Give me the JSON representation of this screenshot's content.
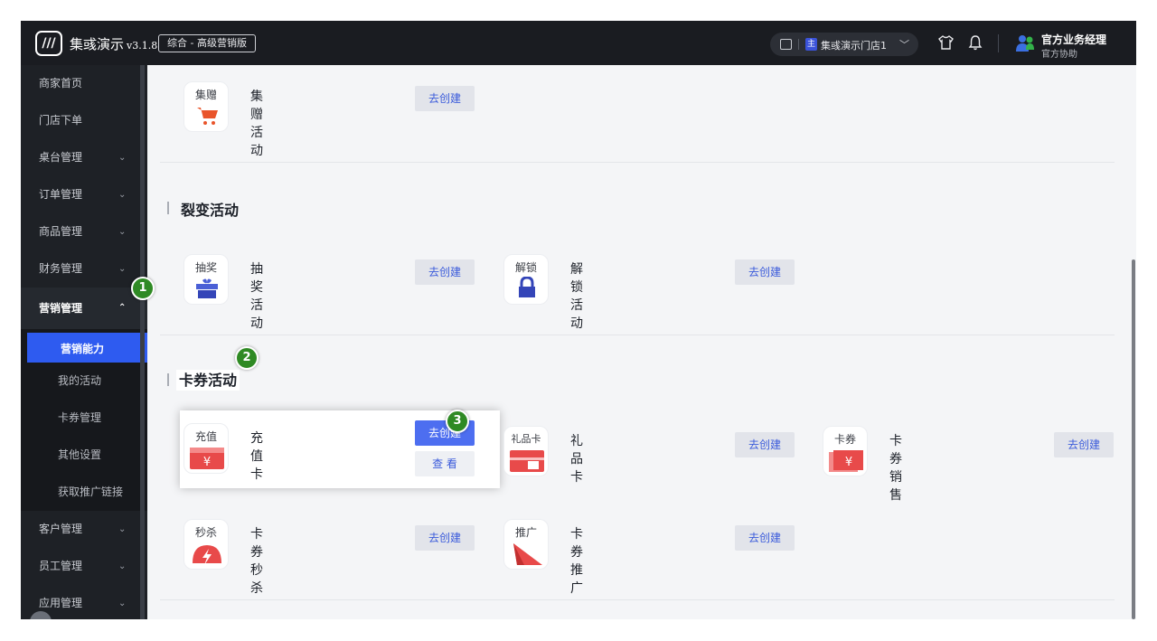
{
  "topbar": {
    "logo_glyph": "///",
    "brand": "集彧演示",
    "version": "v3.1.8",
    "plan": "综合 - 高级营销版",
    "store_tag": "主",
    "store_name": "集彧演示门店1",
    "user_name": "官方业务经理",
    "user_role": "官方协助"
  },
  "sidebar": {
    "items": [
      {
        "label": "商家首页"
      },
      {
        "label": "门店下单"
      },
      {
        "label": "桌台管理"
      },
      {
        "label": "订单管理"
      },
      {
        "label": "商品管理"
      },
      {
        "label": "财务管理"
      },
      {
        "label": "营销管理"
      },
      {
        "label": "客户管理"
      },
      {
        "label": "员工管理"
      },
      {
        "label": "应用管理"
      }
    ],
    "sub_items": [
      {
        "label": "营销能力"
      },
      {
        "label": "我的活动"
      },
      {
        "label": "卡券管理"
      },
      {
        "label": "其他设置"
      },
      {
        "label": "获取推广链接"
      }
    ]
  },
  "sections": {
    "gift": {
      "card": {
        "icon_label": "集赠",
        "name": "集赠活动",
        "button": "去创建"
      }
    },
    "fission": {
      "title": "裂变活动",
      "cards": [
        {
          "icon_label": "抽奖",
          "name": "抽奖活动",
          "button": "去创建"
        },
        {
          "icon_label": "解锁",
          "name": "解锁活动",
          "button": "去创建"
        }
      ]
    },
    "coupon": {
      "title": "卡券活动",
      "cards": [
        {
          "icon_label": "充值",
          "name": "充值卡",
          "button": "去创建",
          "view": "查 看"
        },
        {
          "icon_label": "礼品卡",
          "name": "礼品卡",
          "button": "去创建"
        },
        {
          "icon_label": "卡券",
          "name": "卡券销售",
          "button": "去创建"
        },
        {
          "icon_label": "秒杀",
          "name": "卡券秒杀",
          "button": "去创建"
        },
        {
          "icon_label": "推广",
          "name": "卡券推广",
          "button": "去创建"
        }
      ]
    }
  },
  "markers": [
    "1",
    "2",
    "3"
  ],
  "colors": {
    "accent": "#4d6ef0",
    "sidebar_bg": "#1e2126",
    "marker": "#2f8a24"
  }
}
